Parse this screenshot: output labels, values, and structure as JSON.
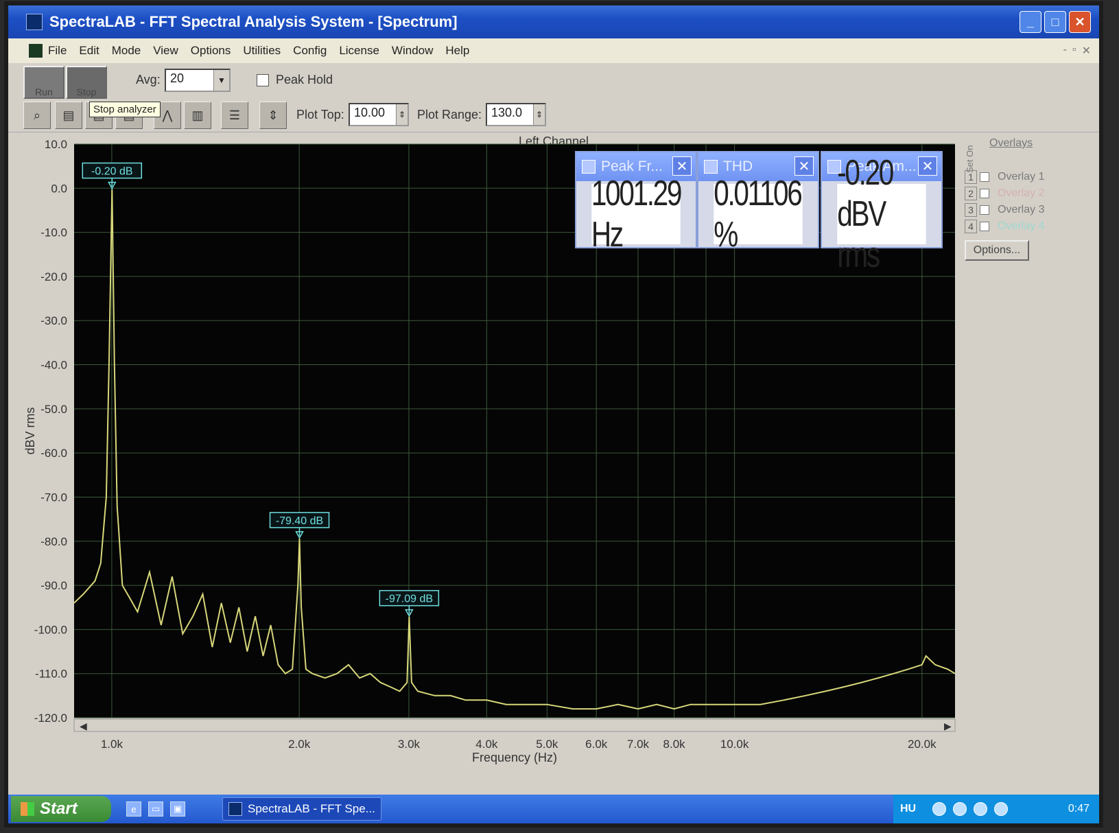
{
  "window": {
    "title": "SpectraLAB - FFT Spectral Analysis System - [Spectrum]",
    "controls": [
      "_",
      "□",
      "✕"
    ]
  },
  "menu": {
    "items": [
      "File",
      "Edit",
      "Mode",
      "View",
      "Options",
      "Utilities",
      "Config",
      "License",
      "Window",
      "Help"
    ],
    "mdi_controls": [
      "-",
      "▫",
      "✕"
    ]
  },
  "toolbar": {
    "run_label": "Run",
    "stop_label": "Stop",
    "avg_label": "Avg:",
    "avg_value": "20",
    "peak_hold_label": "Peak Hold",
    "peak_hold_checked": false,
    "plot_top_label": "Plot Top:",
    "plot_top_value": "10.00",
    "plot_range_label": "Plot Range:",
    "plot_range_value": "130.0",
    "tooltip": "Stop analyzer",
    "icons": [
      "zoom-icon",
      "scale-x-icon",
      "scale-y-icon",
      "scale-z-icon",
      "peak-icon",
      "bars-icon",
      "table-icon",
      "marker-icon"
    ]
  },
  "meters": [
    {
      "title": "Peak Fr...",
      "value": "1001.29 Hz"
    },
    {
      "title": "THD",
      "value": "0.01106 %"
    },
    {
      "title": "Peak Am...",
      "value": "-0.20 dBV rms"
    }
  ],
  "overlays": {
    "header": "Overlays",
    "set_label": "Set On",
    "rows": [
      {
        "num": "1",
        "label": "Overlay 1",
        "color": "#7a7a7a"
      },
      {
        "num": "2",
        "label": "Overlay 2",
        "color": "#d5b0b0"
      },
      {
        "num": "3",
        "label": "Overlay 3",
        "color": "#7a7a7a"
      },
      {
        "num": "4",
        "label": "Overlay 4",
        "color": "#9fd7d0"
      }
    ],
    "options_label": "Options..."
  },
  "chart_data": {
    "type": "line",
    "title": "Left Channel",
    "xlabel": "Frequency (Hz)",
    "ylabel": "dBV rms",
    "x_scale": "log",
    "xlim": [
      870,
      22600
    ],
    "ylim": [
      -120,
      10
    ],
    "y_ticks": [
      "10.0",
      "0.0",
      "-10.0",
      "-20.0",
      "-30.0",
      "-40.0",
      "-50.0",
      "-60.0",
      "-70.0",
      "-80.0",
      "-90.0",
      "-100.0",
      "-110.0",
      "-120.0"
    ],
    "x_ticks": [
      {
        "value": 1000,
        "label": "1.0k"
      },
      {
        "value": 2000,
        "label": "2.0k"
      },
      {
        "value": 3000,
        "label": "3.0k"
      },
      {
        "value": 4000,
        "label": "4.0k"
      },
      {
        "value": 5000,
        "label": "5.0k"
      },
      {
        "value": 6000,
        "label": "6.0k"
      },
      {
        "value": 7000,
        "label": "7.0k"
      },
      {
        "value": 8000,
        "label": "8.0k"
      },
      {
        "value": 10000,
        "label": "10.0k"
      },
      {
        "value": 20000,
        "label": "20.0k"
      }
    ],
    "grid": true,
    "series": [
      {
        "color": "#d8d77a",
        "x": [
          870,
          900,
          940,
          960,
          980,
          990,
          1001,
          1010,
          1020,
          1040,
          1070,
          1100,
          1150,
          1200,
          1250,
          1300,
          1350,
          1400,
          1450,
          1500,
          1550,
          1600,
          1650,
          1700,
          1750,
          1800,
          1850,
          1900,
          1950,
          1990,
          2002,
          2015,
          2050,
          2100,
          2200,
          2300,
          2400,
          2500,
          2600,
          2700,
          2800,
          2900,
          2980,
          3003,
          3030,
          3100,
          3300,
          3500,
          3700,
          4000,
          4300,
          4600,
          5000,
          5500,
          6000,
          6500,
          7000,
          7500,
          8000,
          8500,
          9000,
          10000,
          11000,
          12000,
          13000,
          14000,
          15000,
          16000,
          17000,
          18000,
          19000,
          20000,
          20300,
          21000,
          22000,
          22600
        ],
        "y": [
          -94,
          -92,
          -89,
          -85,
          -70,
          -40,
          -0.2,
          -40,
          -72,
          -90,
          -93,
          -96,
          -87,
          -99,
          -88,
          -101,
          -97,
          -92,
          -104,
          -94,
          -103,
          -95,
          -105,
          -97,
          -106,
          -99,
          -108,
          -110,
          -109,
          -90,
          -79.4,
          -95,
          -109,
          -110,
          -111,
          -110,
          -108,
          -111,
          -110,
          -112,
          -113,
          -114,
          -112,
          -97.09,
          -112,
          -114,
          -115,
          -115,
          -116,
          -116,
          -117,
          -117,
          -117,
          -118,
          -118,
          -117,
          -118,
          -117,
          -118,
          -117,
          -117,
          -117,
          -117,
          -116,
          -115,
          -114,
          -113,
          -112,
          -111,
          -110,
          -109,
          -108,
          -106,
          -108,
          -109,
          -110
        ]
      }
    ],
    "markers": [
      {
        "x": 1001,
        "y": -0.2,
        "label": "-0.20 dB"
      },
      {
        "x": 2002,
        "y": -79.4,
        "label": "-79.40 dB"
      },
      {
        "x": 3003,
        "y": -97.09,
        "label": "-97.09 dB"
      }
    ]
  },
  "taskbar": {
    "start_label": "Start",
    "task_label": "SpectraLAB - FFT Spe...",
    "language": "HU",
    "clock": "0:47",
    "quicklaunch": [
      "ie-icon",
      "desktop-icon",
      "media-icon"
    ]
  }
}
